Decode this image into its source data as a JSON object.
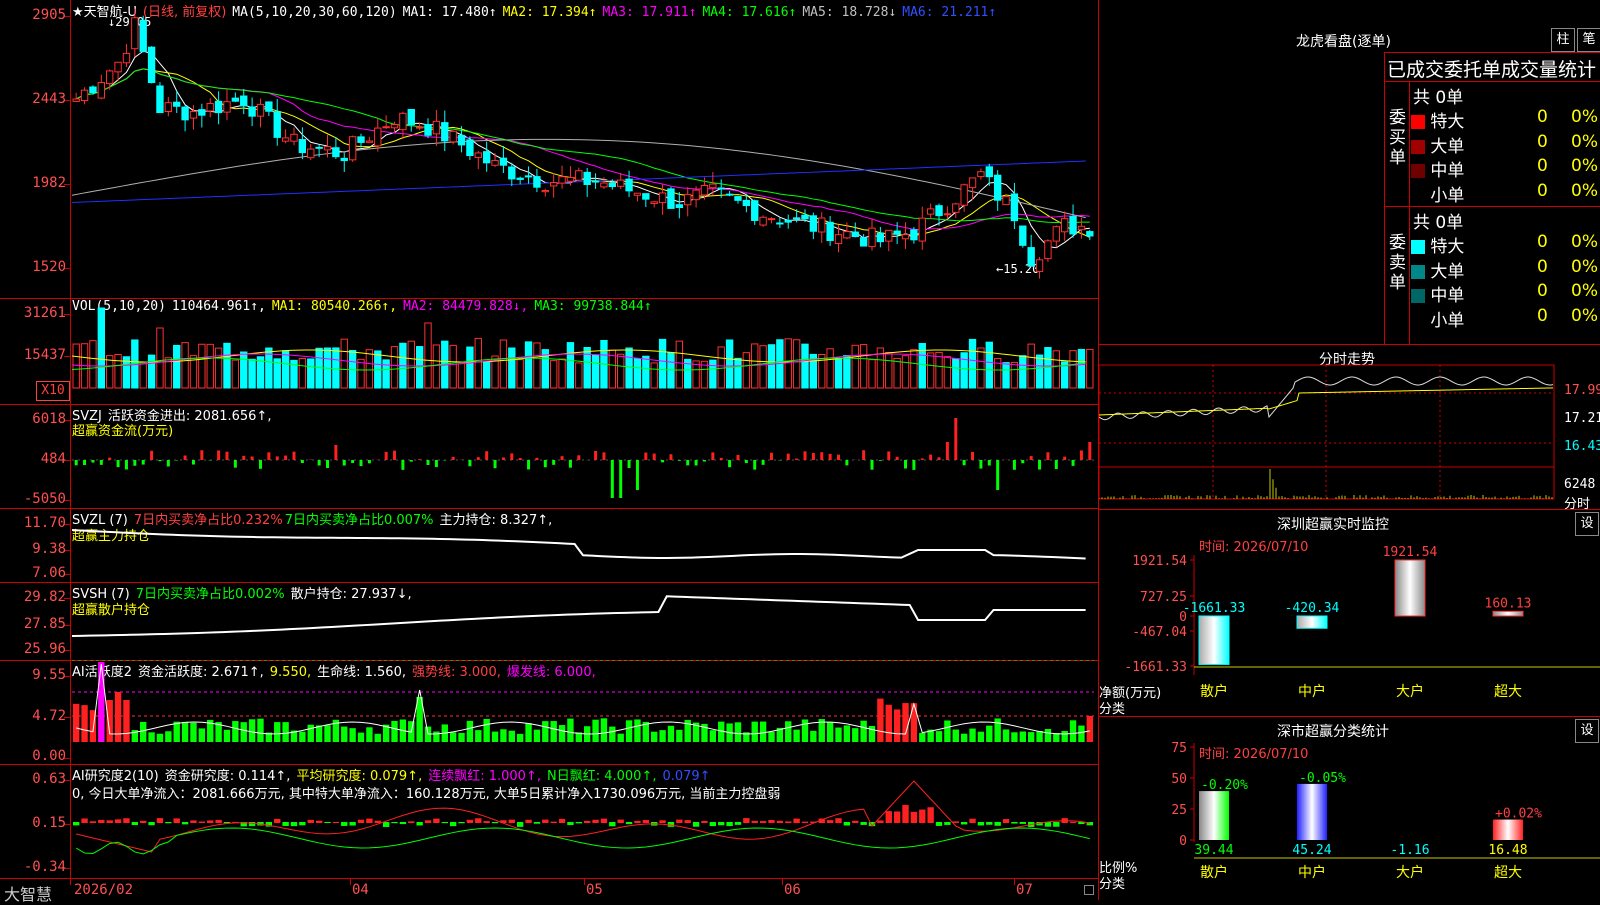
{
  "price_pane": {
    "title_star": "★",
    "stock_name": "天智航-U",
    "mode": "(日线, 前复权)",
    "ma_def": "MA(5,10,20,30,60,120)",
    "ma": [
      {
        "label": "MA1: 17.480↑",
        "color": "#ffffff"
      },
      {
        "label": "MA2: 17.394↑",
        "color": "#ffff00"
      },
      {
        "label": "MA3: 17.911↑",
        "color": "#ff00ff"
      },
      {
        "label": "MA4: 17.616↑",
        "color": "#00ff00"
      },
      {
        "label": "MA5: 18.728↓",
        "color": "#c0c0c0"
      },
      {
        "label": "MA6: 21.211↑",
        "color": "#0000ff"
      }
    ],
    "y_ticks": [
      "2905",
      "2443",
      "1982",
      "1520"
    ],
    "max_label": "29.05",
    "min_label": "15.20"
  },
  "vol_pane": {
    "def": "VOL(5,10,20)",
    "value": "110464.961↑,",
    "ma1": "MA1: 80540.266↑,",
    "ma2": "MA2: 84479.828↓,",
    "ma3": "MA3: 99738.844↑",
    "y_ticks": [
      "31261",
      "15437"
    ],
    "unit": "X10"
  },
  "svzj_pane": {
    "def": "SVZJ",
    "line1": "活跃资金进出: 2081.656↑,",
    "line2": "超赢资金流(万元)",
    "y_ticks": [
      "6018",
      "484",
      "-5050"
    ]
  },
  "svzl_pane": {
    "def": "SVZL (7)",
    "a": "7日内买卖净占比0.232%",
    "b": "7日内买卖净占比0.007%",
    "c": "主力持仓: 8.327↑,",
    "line2": "超赢主力持仓",
    "y_ticks": [
      "11.70",
      "9.38",
      "7.06"
    ]
  },
  "svsh_pane": {
    "def": "SVSH (7)",
    "a": "7日内买卖净占比0.002%",
    "b": "散户持仓: 27.937↓,",
    "line2": "超赢散户持仓",
    "y_ticks": [
      "29.82",
      "27.85",
      "25.96"
    ]
  },
  "ai_active_pane": {
    "def": "AI活跃度2",
    "a": "资金活跃度: 2.671↑,",
    "b": "9.550,",
    "c": "生命线: 1.560,",
    "d": "强势线: 3.000,",
    "e": "爆发线: 6.000,",
    "y_ticks": [
      "9.55",
      "4.72",
      "0.00"
    ]
  },
  "ai_research_pane": {
    "def": "AI研究度2(10)",
    "a": "资金研究度: 0.114↑,",
    "b": "平均研究度: 0.079↑,",
    "c": "连续飘红: 1.000↑,",
    "d": "N日飘红: 4.000↑,",
    "e": "0.079↑",
    "summary": "0, 今日大单净流入：2081.666万元, 其中特大单净流入：160.128万元, 大单5日累计净入1730.096万元, 当前主力控盘弱",
    "y_ticks": [
      "0.63",
      "0.15",
      "-0.34"
    ]
  },
  "x_axis": {
    "labels": [
      "2026/02",
      "04",
      "05",
      "06",
      "07"
    ],
    "brand": "大智慧"
  },
  "dragon_panel": {
    "title": "龙虎看盘(逐单)",
    "btn1": "柱",
    "btn2": "笔",
    "stats_title": "已成交委托单成交量统计",
    "buy_label": "委买单",
    "sell_label": "委卖单",
    "buy_total": "共 0单",
    "sell_total": "共 0单",
    "buy_rows": [
      {
        "name": "特大",
        "qty": "0",
        "pct": "0%",
        "color": "#ff0000"
      },
      {
        "name": "大单",
        "qty": "0",
        "pct": "0%",
        "color": "#a00000"
      },
      {
        "name": "中单",
        "qty": "0",
        "pct": "0%",
        "color": "#700000"
      },
      {
        "name": "小单",
        "qty": "0",
        "pct": "0%",
        "color": "#000000"
      }
    ],
    "sell_rows": [
      {
        "name": "特大",
        "qty": "0",
        "pct": "0%",
        "color": "#00ffff"
      },
      {
        "name": "大单",
        "qty": "0",
        "pct": "0%",
        "color": "#008888"
      },
      {
        "name": "中单",
        "qty": "0",
        "pct": "0%",
        "color": "#006666"
      },
      {
        "name": "小单",
        "qty": "0",
        "pct": "0%",
        "color": "#000000"
      }
    ]
  },
  "intraday": {
    "title": "分时走势",
    "y_labels": [
      "17.99",
      "17.21",
      "16.43",
      "6248"
    ],
    "sub_label": "分时"
  },
  "sz_monitor": {
    "title": "深圳超赢实时监控",
    "btn": "设",
    "time": "时间: 2026/07/10",
    "y_labels": [
      "1921.54",
      "727.25",
      "0",
      "-467.04",
      "-1661.33"
    ],
    "net_label": "净额(万元)",
    "class_label": "分类",
    "categories": [
      "散户",
      "中户",
      "大户",
      "超大"
    ],
    "values": [
      "-1661.33",
      "-420.34",
      "1921.54",
      "160.13"
    ]
  },
  "sz_class": {
    "title": "深市超赢分类统计",
    "btn": "设",
    "time": "时间: 2026/07/10",
    "y_labels": [
      "75",
      "50",
      "25",
      "0"
    ],
    "ratio_label": "比例%",
    "class_label": "分类",
    "categories": [
      "散户",
      "中户",
      "大户",
      "超大"
    ],
    "pct_changes": [
      "-0.20%",
      "-0.05%",
      "",
      "+0.02%"
    ],
    "values": [
      "39.44",
      "45.24",
      "-1.16",
      "16.48"
    ]
  }
}
